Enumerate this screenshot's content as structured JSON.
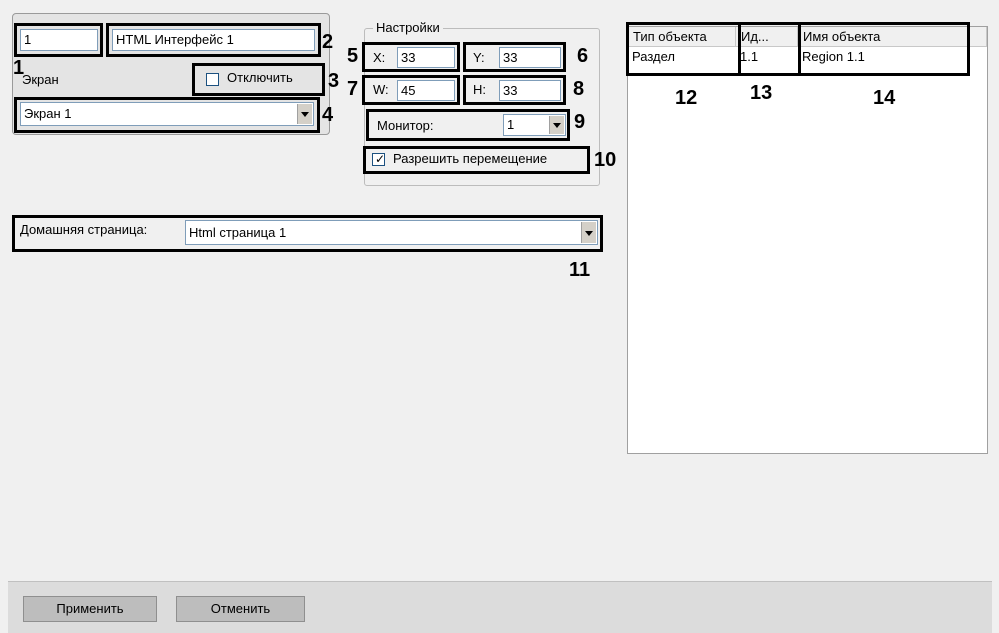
{
  "object": {
    "id": "1",
    "name": "HTML Интерфейс 1",
    "screen_label": "Экран",
    "disable_label": "Отключить",
    "disable_checked": false,
    "screen_value": "Экран 1"
  },
  "settings": {
    "group_label": "Настройки",
    "x_label": "X:",
    "x_value": "33",
    "y_label": "Y:",
    "y_value": "33",
    "w_label": "W:",
    "w_value": "45",
    "h_label": "H:",
    "h_value": "33",
    "monitor_label": "Монитор:",
    "monitor_value": "1",
    "allow_move_label": "Разрешить перемещение",
    "allow_move_checked": true
  },
  "home_page": {
    "label": "Домашняя страница:",
    "value": "Html страница 1"
  },
  "table": {
    "columns": [
      "Тип объекта",
      "Ид...",
      "Имя объекта"
    ],
    "rows": [
      [
        "Раздел",
        "1.1",
        "Region 1.1"
      ]
    ]
  },
  "callouts": [
    "1",
    "2",
    "3",
    "4",
    "5",
    "6",
    "7",
    "8",
    "9",
    "10",
    "11",
    "12",
    "13",
    "14"
  ],
  "buttons": {
    "apply": "Применить",
    "cancel": "Отменить"
  }
}
